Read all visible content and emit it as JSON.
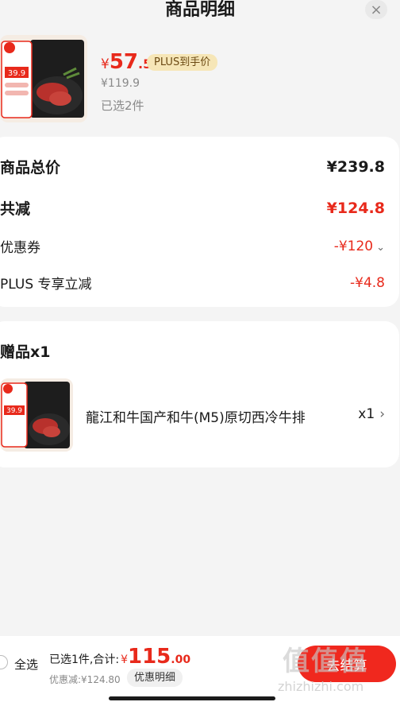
{
  "header": {
    "title": "商品明细",
    "close_label": "×"
  },
  "product": {
    "price_symbol": "¥",
    "price_int": "57",
    "price_dec": ".5",
    "plus_tag": "PLUS到手价",
    "original_price": "¥119.9",
    "selected": "已选2件",
    "thumb_tag": "39.9"
  },
  "summary": {
    "rows": [
      {
        "label": "商品总价",
        "value": "¥239.8"
      },
      {
        "label": "共减",
        "value": "¥124.8"
      },
      {
        "label": "优惠券",
        "value": "-¥120"
      },
      {
        "label": "PLUS 专享立减",
        "value": "-¥4.8"
      }
    ]
  },
  "gift": {
    "title": "赠品x1",
    "item_name": "龍江和牛国产和牛(M5)原切西冷牛排",
    "quantity": "x1",
    "thumb_tag": "39.9"
  },
  "bottom": {
    "select_all": "全选",
    "total_label": "已选1件,合计:",
    "total_symbol": "¥",
    "total_int": "115",
    "total_dec": ".00",
    "discount_text": "优惠减:¥124.80",
    "detail_button": "优惠明细",
    "checkout_button": "去结算"
  },
  "watermark": {
    "big": "值值值",
    "small": "zhizhizhi.com"
  },
  "colors": {
    "accent": "#e8291b",
    "plus_tag_bg": "#f6e6b7"
  }
}
